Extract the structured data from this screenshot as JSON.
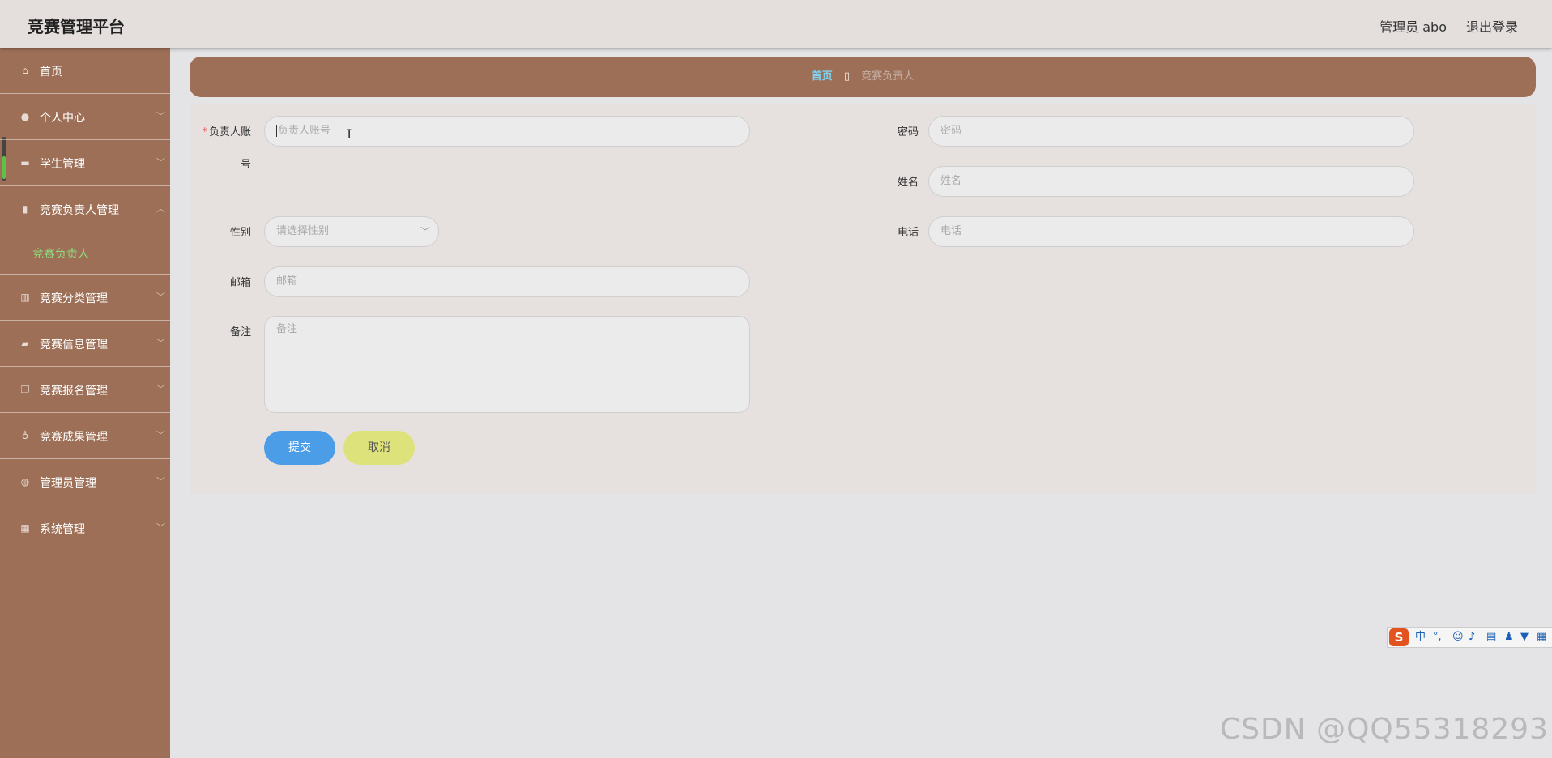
{
  "header": {
    "app_title": "竞赛管理平台",
    "admin_label": "管理员 abo",
    "logout": "退出登录"
  },
  "sidebar": {
    "items": [
      {
        "label": "首页",
        "icon": "home-icon"
      },
      {
        "label": "个人中心",
        "icon": "user-icon"
      },
      {
        "label": "学生管理",
        "icon": "monitor-icon"
      },
      {
        "label": "竞赛负责人管理",
        "icon": "clipboard-icon"
      },
      {
        "label": "竞赛分类管理",
        "icon": "chart-icon"
      },
      {
        "label": "竞赛信息管理",
        "icon": "chat-icon"
      },
      {
        "label": "竞赛报名管理",
        "icon": "copy-icon"
      },
      {
        "label": "竞赛成果管理",
        "icon": "mic-icon"
      },
      {
        "label": "管理员管理",
        "icon": "globe-icon"
      },
      {
        "label": "系统管理",
        "icon": "grid-icon"
      }
    ],
    "sub_item": "竞赛负责人"
  },
  "breadcrumb": {
    "home": "首页",
    "separator": "▯",
    "current": "竞赛负责人"
  },
  "form": {
    "account": {
      "label_line1": "负责人账",
      "label_line2": "号",
      "placeholder": "负责人账号",
      "required": "*"
    },
    "password": {
      "label": "密码",
      "placeholder": "密码"
    },
    "name": {
      "label": "姓名",
      "placeholder": "姓名"
    },
    "gender": {
      "label": "性别",
      "placeholder": "请选择性别"
    },
    "phone": {
      "label": "电话",
      "placeholder": "电话"
    },
    "email": {
      "label": "邮箱",
      "placeholder": "邮箱"
    },
    "remark": {
      "label": "备注",
      "placeholder": "备注"
    },
    "submit": "提交",
    "cancel": "取消"
  },
  "ime": {
    "logo": "S",
    "mode": "中"
  },
  "watermark": "CSDN @QQ55318293",
  "colors": {
    "sidebar": "#9e6f57",
    "header": "#e4dedd",
    "submit": "#4b9de8",
    "cancel": "#dde27a",
    "active_sub": "#8fe07f"
  }
}
